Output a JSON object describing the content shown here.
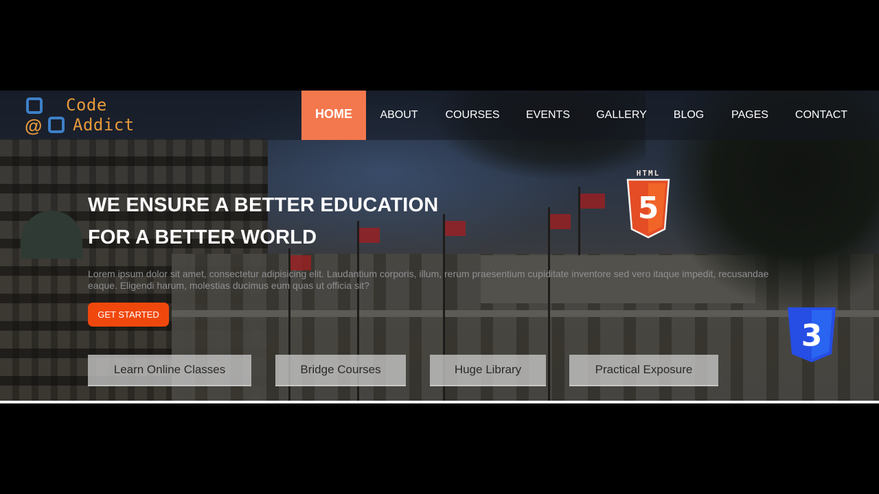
{
  "brand": {
    "line1": "Code",
    "line2": "Addict",
    "at": "@"
  },
  "nav": [
    {
      "label": "HOME",
      "active": true
    },
    {
      "label": "ABOUT"
    },
    {
      "label": "COURSES"
    },
    {
      "label": "EVENTS"
    },
    {
      "label": "GALLERY"
    },
    {
      "label": "BLOG"
    },
    {
      "label": "PAGES"
    },
    {
      "label": "CONTACT"
    }
  ],
  "hero": {
    "headline_line1": "WE ENSURE A BETTER EDUCATION",
    "headline_line2": "FOR A BETTER WORLD",
    "lorem": "Lorem ipsum dolor sit amet, consectetur adipisicing elit. Laudantium corporis, illum, rerum praesentium cupiditate inventore sed vero itaque impedit, recusandae eaque. Eligendi harum, molestias ducimus eum quas ut officia sit?",
    "cta_label": "GET STARTED"
  },
  "features": [
    "Learn Online Classes",
    "Bridge Courses",
    "Huge Library",
    "Practical Exposure"
  ],
  "badges": {
    "html5_label": "HTML",
    "html5_number": "5",
    "css3_number": "3"
  },
  "colors": {
    "accent": "#f4784e",
    "cta": "#f0480c",
    "logo_blue": "#3d80c8",
    "logo_orange": "#e89a3c",
    "html5": "#e44d26",
    "css3": "#264de4"
  }
}
